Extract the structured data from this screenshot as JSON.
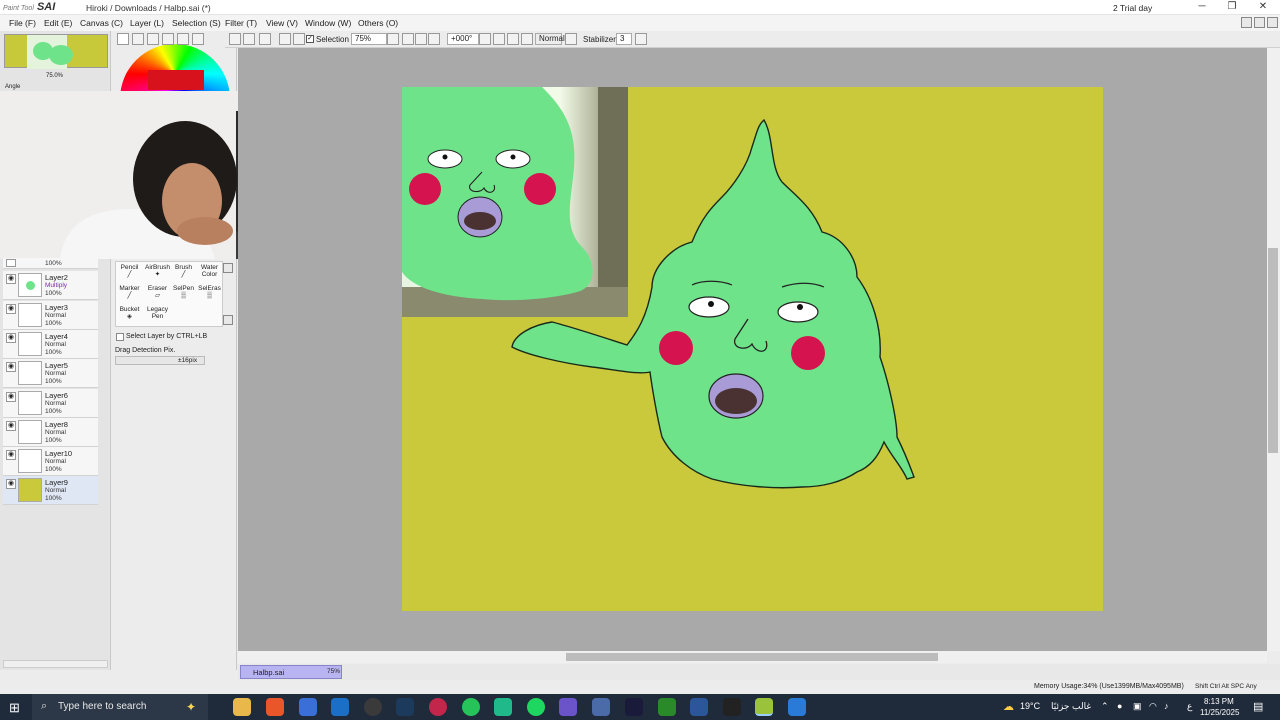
{
  "titlebar": {
    "app_logo": "SAI",
    "app_logo_small": "Paint Tool",
    "doc_path": "Hiroki  /  Downloads / Halbp.sai (*)",
    "trial": "2 Trial day"
  },
  "menu": [
    "File (F)",
    "Edit (E)",
    "Canvas (C)",
    "Layer (L)",
    "Selection (S)",
    "Filter (T)",
    "View (V)",
    "Window (W)",
    "Others (O)"
  ],
  "toolbar": {
    "selection_label": "Selection",
    "zoom": "75%",
    "angle": "+000°",
    "blend": "Normal",
    "stabilizer_label": "Stabilizer",
    "stabilizer_value": "3"
  },
  "nav": {
    "zoom_label": "75.0%",
    "angle_label": "Angle"
  },
  "layers": [
    {
      "name": "",
      "mode": "",
      "opacity": "100%"
    },
    {
      "name": "Layer2",
      "mode": "Multiply",
      "opacity": "100%"
    },
    {
      "name": "Layer3",
      "mode": "Normal",
      "opacity": "100%"
    },
    {
      "name": "Layer4",
      "mode": "Normal",
      "opacity": "100%"
    },
    {
      "name": "Layer5",
      "mode": "Normal",
      "opacity": "100%"
    },
    {
      "name": "Layer6",
      "mode": "Normal",
      "opacity": "100%"
    },
    {
      "name": "Layer8",
      "mode": "Normal",
      "opacity": "100%"
    },
    {
      "name": "Layer10",
      "mode": "Normal",
      "opacity": "100%"
    },
    {
      "name": "Layer9",
      "mode": "Normal",
      "opacity": "100%"
    }
  ],
  "tools": [
    [
      "Pencil",
      "AirBrush",
      "Brush",
      "Water Color"
    ],
    [
      "Marker",
      "Eraser",
      "SelPen",
      "SelEras"
    ],
    [
      "Bucket",
      "Legacy Pen",
      "",
      ""
    ]
  ],
  "tool_options": {
    "select_layer": "Select Layer by CTRL+LB",
    "drag_detection": "Drag Detection Pix.",
    "drag_value": "±16pix"
  },
  "doc_tab": {
    "name": "Halbp.sai",
    "zoom": "75%"
  },
  "status": {
    "memory": "Memory Usage:34% (Use1399MB/Max4095MB)",
    "keys": "Shift Ctrl Alt SPC Any"
  },
  "taskbar": {
    "search_placeholder": "Type here to search",
    "weather": "19°C",
    "weather_text": "غالب جزئيًا",
    "time": "8:13 PM",
    "date": "11/25/2025",
    "lang": "ع"
  },
  "colors": {
    "canvas_bg": "#c9c93b",
    "char_green": "#6ee38a",
    "cheek": "#d4134f",
    "mouth": "#a89bd6",
    "doc_tab": "#b8b4f2"
  }
}
